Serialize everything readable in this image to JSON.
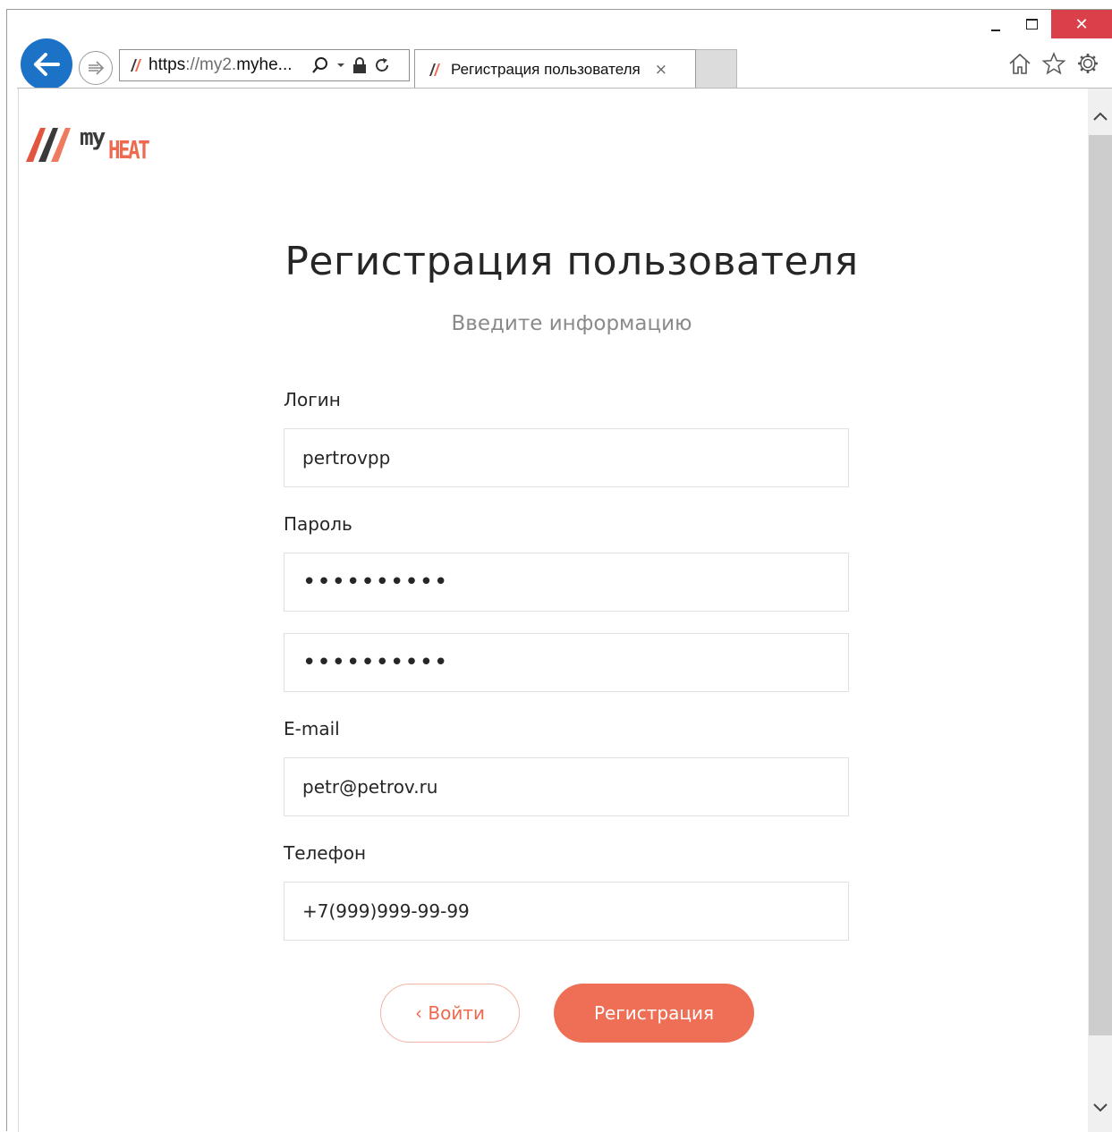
{
  "browser": {
    "address_scheme": "https",
    "address_rest_dim": "://my2.",
    "address_host_end": "myhe...",
    "tab_title": "Регистрация пользователя",
    "tab_close_glyph": "×",
    "close_glyph": "✕",
    "icons": [
      "back-arrow-icon",
      "forward-arrow-icon",
      "search-icon",
      "dropdown-icon",
      "lock-icon",
      "refresh-icon",
      "home-icon",
      "star-icon",
      "gear-icon"
    ]
  },
  "brand": {
    "logo_my": "my",
    "logo_heat": "HEAT",
    "accent_color": "#ee6a4f"
  },
  "form": {
    "title": "Регистрация пользователя",
    "subtitle": "Введите информацию",
    "login_label": "Логин",
    "login_value": "pertrovpp",
    "password_label": "Пароль",
    "password_value": "••••••••••",
    "password_confirm_value": "••••••••••",
    "email_label": "E-mail",
    "email_value": "petr@petrov.ru",
    "phone_label": "Телефон",
    "phone_value": "+7(999)999-99-99",
    "login_button": "‹ Войти",
    "register_button": "Регистрация"
  }
}
